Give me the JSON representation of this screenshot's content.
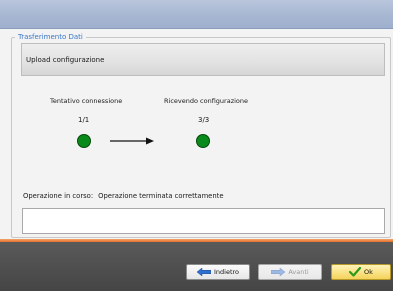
{
  "window": {
    "title": ""
  },
  "group": {
    "legend": "Trasferimento Dati"
  },
  "header": {
    "title": "Upload configurazione"
  },
  "steps": [
    {
      "label": "Tentativo connessione",
      "count": "1/1",
      "status_color": "#0a8a1a"
    },
    {
      "label": "Ricevendo configurazione",
      "count": "3/3",
      "status_color": "#0a8a1a"
    }
  ],
  "operation": {
    "label": "Operazione in corso:",
    "value": "Operazione terminata correttamente"
  },
  "log": {
    "value": ""
  },
  "buttons": {
    "back": {
      "label": "Indietro",
      "icon": "arrow-left-icon"
    },
    "next": {
      "label": "Avanti",
      "icon": "arrow-right-icon",
      "enabled": false
    },
    "ok": {
      "label": "Ok",
      "icon": "checkmark-icon"
    }
  },
  "colors": {
    "accent_orange": "#e86f2a",
    "success_green": "#0a8a1a",
    "legend_blue": "#3a76c9"
  }
}
